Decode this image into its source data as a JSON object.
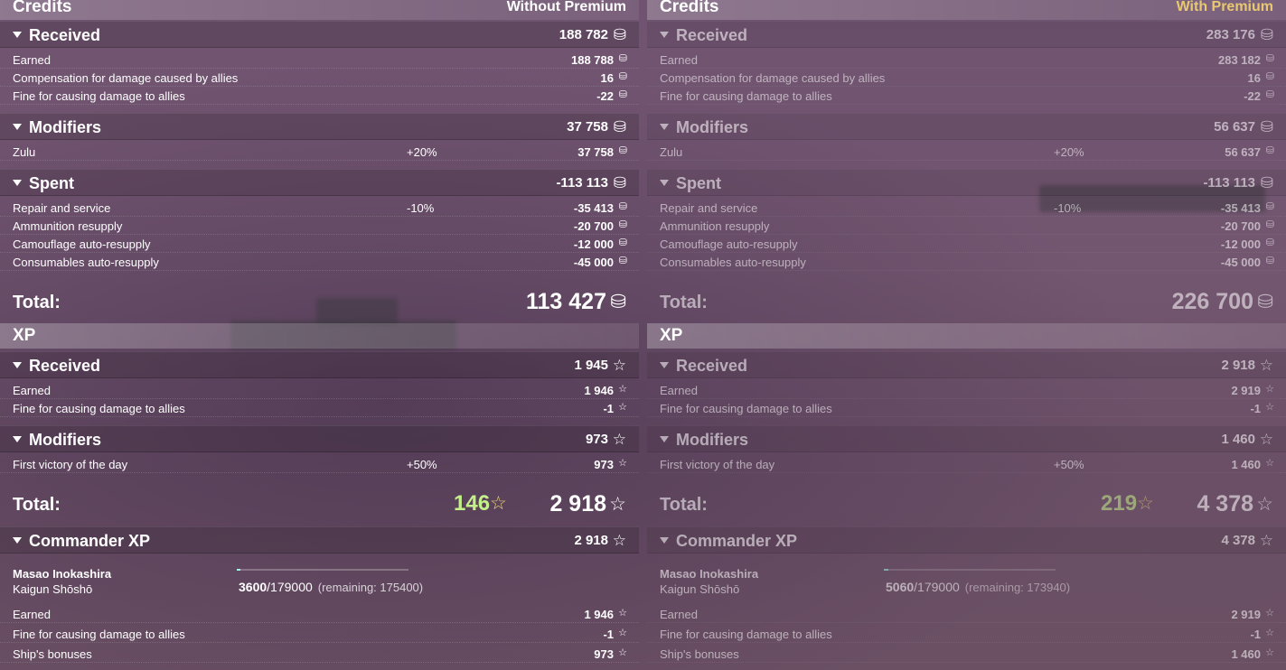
{
  "columns": [
    {
      "credits_title": "Credits",
      "premium_label": "Without Premium",
      "credits_received": {
        "label": "Received",
        "value": "188 782",
        "rows": [
          {
            "label": "Earned",
            "value": "188 788"
          },
          {
            "label": "Compensation for damage caused by allies",
            "value": "16"
          },
          {
            "label": "Fine for causing damage to allies",
            "value": "-22"
          }
        ]
      },
      "credits_modifiers": {
        "label": "Modifiers",
        "value": "37 758",
        "rows": [
          {
            "label": "Zulu",
            "mod": "+20%",
            "value": "37 758"
          }
        ]
      },
      "credits_spent": {
        "label": "Spent",
        "value": "-113 113",
        "rows": [
          {
            "label": "Repair and service",
            "mod": "-10%",
            "value": "-35 413"
          },
          {
            "label": "Ammunition resupply",
            "value": "-20 700"
          },
          {
            "label": "Camouflage auto-resupply",
            "value": "-12 000"
          },
          {
            "label": "Consumables auto-resupply",
            "value": "-45 000"
          }
        ]
      },
      "credits_total": {
        "label": "Total:",
        "value": "113 427"
      },
      "xp_title": "XP",
      "xp_received": {
        "label": "Received",
        "value": "1 945",
        "rows": [
          {
            "label": "Earned",
            "value": "1 946"
          },
          {
            "label": "Fine for causing damage to allies",
            "value": "-1"
          }
        ]
      },
      "xp_modifiers": {
        "label": "Modifiers",
        "value": "973",
        "rows": [
          {
            "label": "First victory of the day",
            "mod": "+50%",
            "value": "973"
          }
        ]
      },
      "xp_total": {
        "label": "Total:",
        "bonus": "146",
        "value": "2 918"
      },
      "commander": {
        "label": "Commander XP",
        "value": "2 918",
        "name": "Masao Inokashira",
        "rank": "Kaigun Shōshō",
        "current": "3600",
        "max": "/179000",
        "remaining": "(remaining: 175400)",
        "progress": 0.02,
        "rows": [
          {
            "label": "Earned",
            "value": "1 946"
          },
          {
            "label": "Fine for causing damage to allies",
            "value": "-1"
          },
          {
            "label": "Ship's bonuses",
            "value": "973"
          }
        ]
      }
    },
    {
      "credits_title": "Credits",
      "premium_label": "With Premium",
      "credits_received": {
        "label": "Received",
        "value": "283 176",
        "rows": [
          {
            "label": "Earned",
            "value": "283 182"
          },
          {
            "label": "Compensation for damage caused by allies",
            "value": "16"
          },
          {
            "label": "Fine for causing damage to allies",
            "value": "-22"
          }
        ]
      },
      "credits_modifiers": {
        "label": "Modifiers",
        "value": "56 637",
        "rows": [
          {
            "label": "Zulu",
            "mod": "+20%",
            "value": "56 637"
          }
        ]
      },
      "credits_spent": {
        "label": "Spent",
        "value": "-113 113",
        "rows": [
          {
            "label": "Repair and service",
            "mod": "-10%",
            "value": "-35 413"
          },
          {
            "label": "Ammunition resupply",
            "value": "-20 700"
          },
          {
            "label": "Camouflage auto-resupply",
            "value": "-12 000"
          },
          {
            "label": "Consumables auto-resupply",
            "value": "-45 000"
          }
        ]
      },
      "credits_total": {
        "label": "Total:",
        "value": "226 700"
      },
      "xp_title": "XP",
      "xp_received": {
        "label": "Received",
        "value": "2 918",
        "rows": [
          {
            "label": "Earned",
            "value": "2 919"
          },
          {
            "label": "Fine for causing damage to allies",
            "value": "-1"
          }
        ]
      },
      "xp_modifiers": {
        "label": "Modifiers",
        "value": "1 460",
        "rows": [
          {
            "label": "First victory of the day",
            "mod": "+50%",
            "value": "1 460"
          }
        ]
      },
      "xp_total": {
        "label": "Total:",
        "bonus": "219",
        "value": "4 378"
      },
      "commander": {
        "label": "Commander XP",
        "value": "4 378",
        "name": "Masao Inokashira",
        "rank": "Kaigun Shōshō",
        "current": "5060",
        "max": "/179000",
        "remaining": "(remaining: 173940)",
        "progress": 0.028,
        "rows": [
          {
            "label": "Earned",
            "value": "2 919"
          },
          {
            "label": "Fine for causing damage to allies",
            "value": "-1"
          },
          {
            "label": "Ship's bonuses",
            "value": "1 460"
          }
        ]
      }
    }
  ],
  "icons": {
    "credits": "coin-icon",
    "xp": "star-icon"
  },
  "colors": {
    "premium": "#e8c870",
    "bonus_xp": "#c4f08a",
    "progress": "#9ff2e6"
  }
}
